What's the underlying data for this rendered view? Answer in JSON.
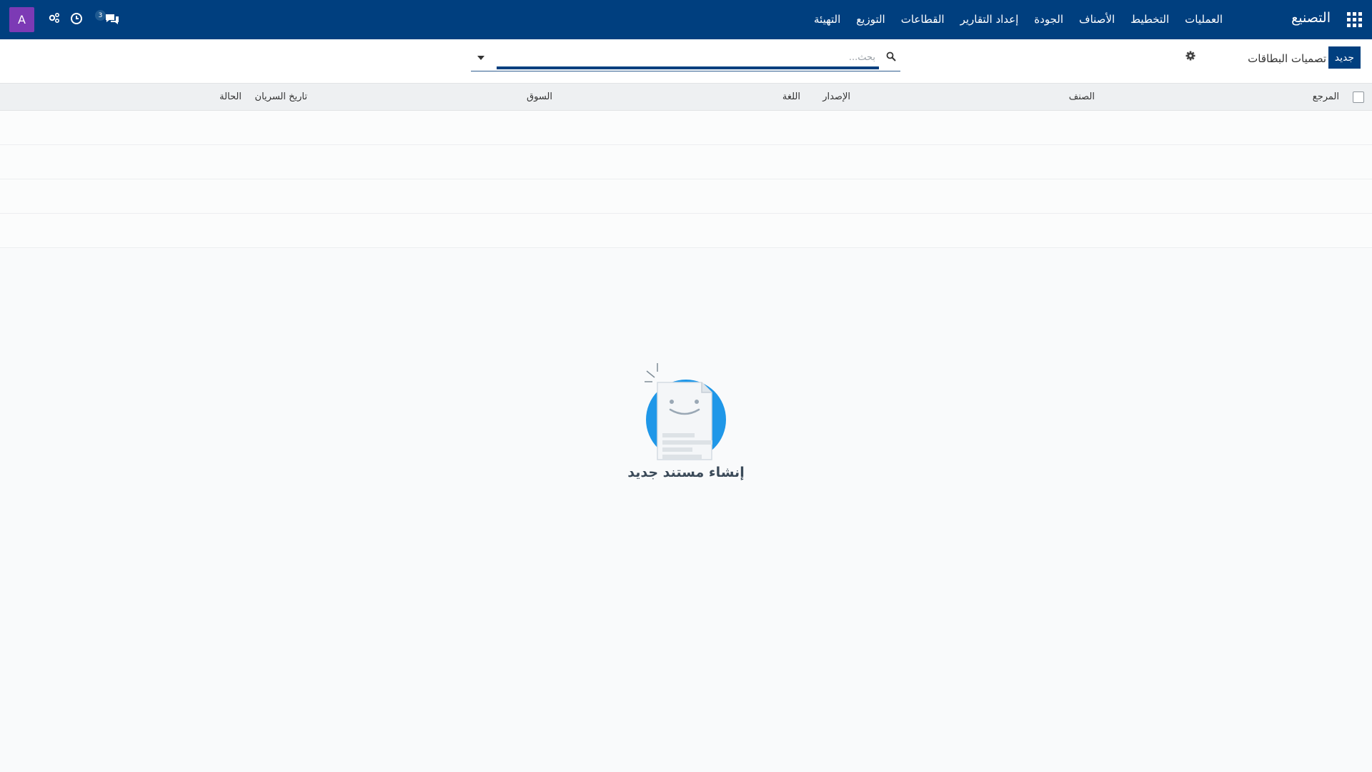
{
  "navbar": {
    "brand": "التصنيع",
    "menu": [
      "العمليات",
      "التخطيط",
      "الأصناف",
      "الجودة",
      "إعداد التقارير",
      "القطاعات",
      "التوزيع",
      "التهيئة"
    ],
    "user_initial": "A",
    "chat_count": "3",
    "colors": {
      "background": "#003f7f",
      "avatar": "#7c3ab5"
    }
  },
  "control_panel": {
    "new_label": "جديد",
    "view_title": "تصميات البطاقات",
    "search_placeholder": "بحث..."
  },
  "list": {
    "columns": [
      "المرجع",
      "الصنف",
      "الإصدار",
      "اللغة",
      "السوق",
      "تاريخ السريان",
      "الحالة"
    ]
  },
  "empty_state": {
    "title": "إنشاء مستند جديد"
  }
}
